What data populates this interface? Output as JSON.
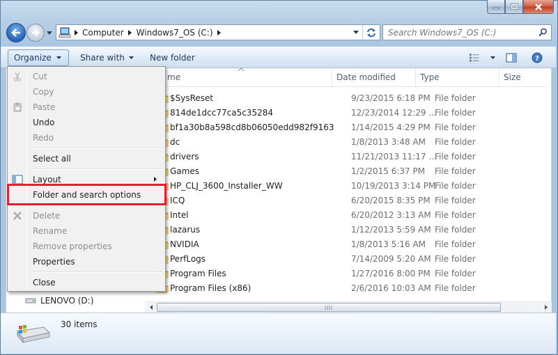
{
  "window": {
    "caption_buttons": [
      "minimize-icon",
      "maximize-icon",
      "close-icon"
    ]
  },
  "address": {
    "crumbs": [
      "Computer",
      "Windows7_OS (C:)"
    ]
  },
  "search": {
    "placeholder": "Search Windows7_OS (C:)"
  },
  "toolbar": {
    "organize": "Organize",
    "share_with": "Share with",
    "new_folder": "New folder"
  },
  "columns": {
    "name": "me",
    "date": "Date modified",
    "type": "Type",
    "size": "Size"
  },
  "rows": [
    {
      "name": "$SysReset",
      "date": "9/23/2015 6:18 PM",
      "type": "File folder"
    },
    {
      "name": "814de1dcc77ca5c35284",
      "date": "12/23/2014 12:29 ...",
      "type": "File folder"
    },
    {
      "name": "bf1a30b8a598cd8b06050edd982f9163",
      "date": "1/14/2015 4:29 PM",
      "type": "File folder"
    },
    {
      "name": "dc",
      "date": "1/8/2013 3:48 AM",
      "type": "File folder"
    },
    {
      "name": "drivers",
      "date": "11/21/2013 11:17 ...",
      "type": "File folder"
    },
    {
      "name": "Games",
      "date": "1/2/2015 6:37 PM",
      "type": "File folder"
    },
    {
      "name": "HP_CLJ_3600_Installer_WW",
      "date": "10/19/2013 3:14 PM",
      "type": "File folder"
    },
    {
      "name": "ICQ",
      "date": "6/20/2015 8:35 PM",
      "type": "File folder"
    },
    {
      "name": "Intel",
      "date": "6/20/2012 3:13 AM",
      "type": "File folder"
    },
    {
      "name": "lazarus",
      "date": "1/12/2013 5:59 AM",
      "type": "File folder"
    },
    {
      "name": "NVIDIA",
      "date": "1/8/2013 5:16 AM",
      "type": "File folder"
    },
    {
      "name": "PerfLogs",
      "date": "7/14/2009 5:20 AM",
      "type": "File folder"
    },
    {
      "name": "Program Files",
      "date": "1/27/2016 8:00 PM",
      "type": "File folder"
    },
    {
      "name": "Program Files (x86)",
      "date": "2/6/2016 10:03 AM",
      "type": "File folder"
    }
  ],
  "nav_pane": {
    "drive_d": "LENOVO (D:)"
  },
  "menu": {
    "cut": "Cut",
    "copy": "Copy",
    "paste": "Paste",
    "undo": "Undo",
    "redo": "Redo",
    "select_all": "Select all",
    "layout": "Layout",
    "folder_options": "Folder and search options",
    "delete": "Delete",
    "rename": "Rename",
    "remove_properties": "Remove properties",
    "properties": "Properties",
    "close": "Close"
  },
  "status": {
    "count": "30 items"
  },
  "colors": {
    "highlight": "#e4202f",
    "folder": "#e8c15a",
    "disabled_text": "#8d8d8d"
  }
}
